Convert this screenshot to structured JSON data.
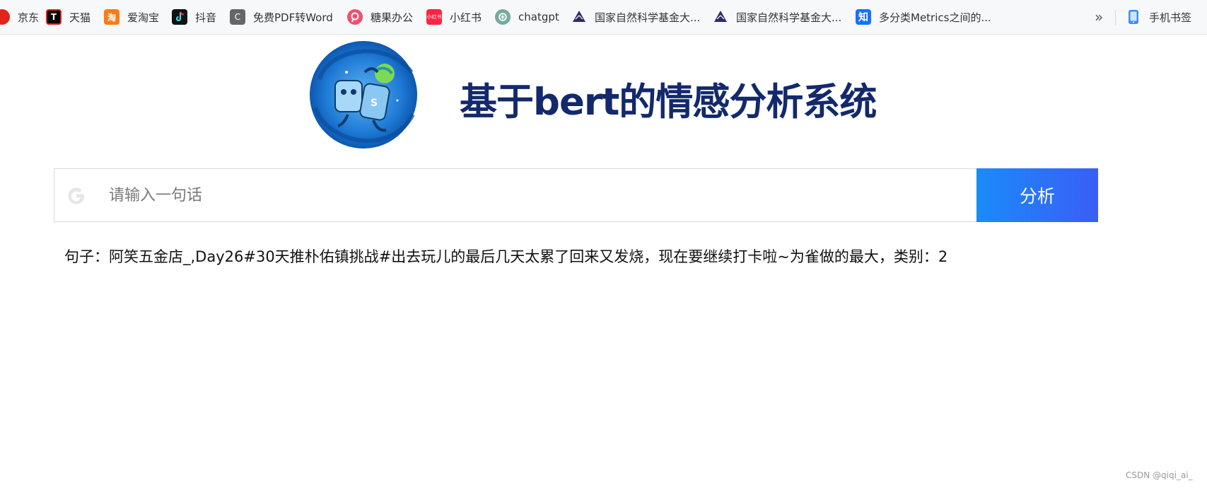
{
  "bookmarks": {
    "items": [
      {
        "label": "京东",
        "icon": "jd-icon",
        "color": "#e1251b"
      },
      {
        "label": "天猫",
        "icon": "tmall-icon",
        "color": "#000000"
      },
      {
        "label": "爱淘宝",
        "icon": "taobao-icon",
        "color": "#ff5000"
      },
      {
        "label": "抖音",
        "icon": "douyin-icon",
        "color": "#111111"
      },
      {
        "label": "免费PDF转Word",
        "icon": "pdf-convert-icon",
        "color": "#555555"
      },
      {
        "label": "糖果办公",
        "icon": "candy-office-icon",
        "color": "#f0506e"
      },
      {
        "label": "小红书",
        "icon": "xiaohongshu-icon",
        "color": "#ff2442"
      },
      {
        "label": "chatgpt",
        "icon": "chatgpt-icon",
        "color": "#74aa9c"
      },
      {
        "label": "国家自然科学基金大...",
        "icon": "nsfc-icon",
        "color": "#2b2b6b"
      },
      {
        "label": "国家自然科学基金大...",
        "icon": "nsfc-icon",
        "color": "#2b2b6b"
      },
      {
        "label": "多分类Metrics之间的...",
        "icon": "zhihu-icon",
        "color": "#1772f6"
      }
    ],
    "icon_glyphs": {
      "tmall": "T",
      "taobao": "淘",
      "pdf": "C",
      "xiaohongshu": "小红书",
      "zhihu": "知"
    },
    "more": "»",
    "mobile_bookmarks": "手机书签"
  },
  "header": {
    "title": "基于bert的情感分析系统",
    "logo": "robot-logo-icon"
  },
  "search": {
    "placeholder": "请输入一句话",
    "value": "",
    "button_label": "分析",
    "button_colors": [
      "#1a8bf9",
      "#3a5ef5"
    ]
  },
  "result": {
    "text": "句子：阿笑五金店_,Day26#30天推朴佑镇挑战#出去玩儿的最后几天太累了回来又发烧，现在要继续打卡啦~为雀做的最大，类别：2"
  },
  "watermark": "CSDN @qiqi_ai_"
}
